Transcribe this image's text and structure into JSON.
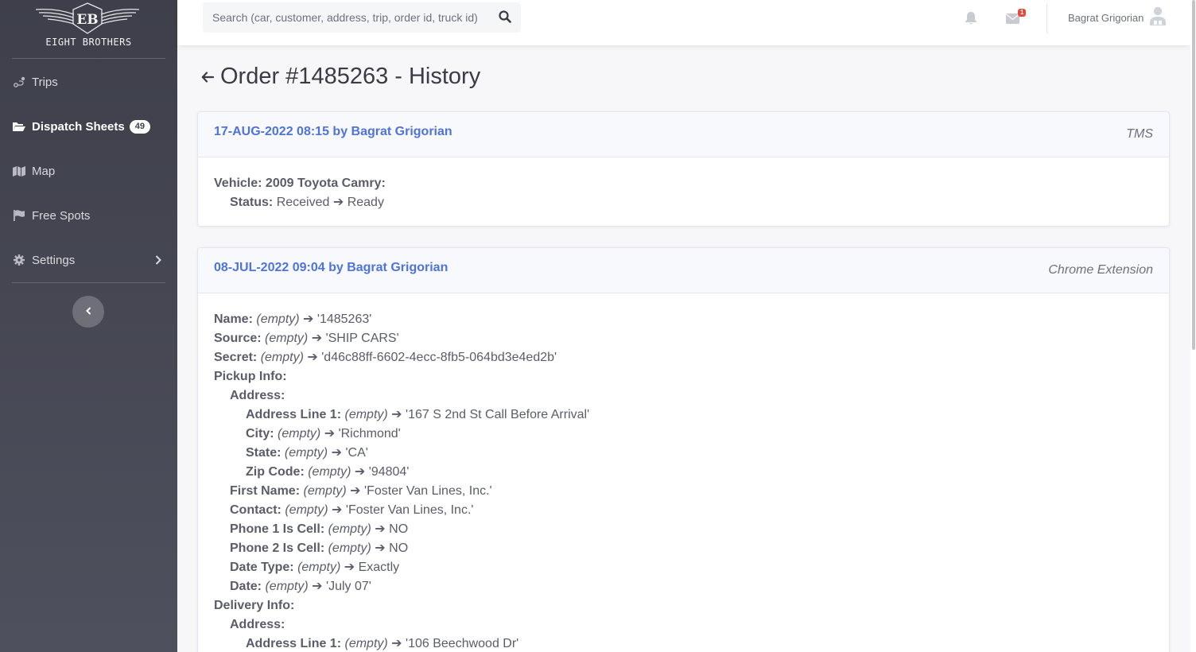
{
  "brand": {
    "name": "EIGHT BROTHERS"
  },
  "sidebar": {
    "items": [
      {
        "label": "Trips",
        "icon": "route-icon"
      },
      {
        "label": "Dispatch Sheets",
        "icon": "folder-open-icon",
        "badge": "49"
      },
      {
        "label": "Map",
        "icon": "map-icon"
      },
      {
        "label": "Free Spots",
        "icon": "flag-icon"
      },
      {
        "label": "Settings",
        "icon": "gear-icon"
      }
    ]
  },
  "topbar": {
    "search_placeholder": "Search (car, customer, address, trip, order id, truck id)",
    "mail_count": "1",
    "user_name": "Bagrat Grigorian"
  },
  "page": {
    "title": "Order #1485263 - History"
  },
  "entries": [
    {
      "header": "17-AUG-2022 08:15 by Bagrat Grigorian",
      "source": "TMS",
      "vehicle_line": "Vehicle: 2009 Toyota Camry:",
      "status_key": "Status:",
      "status_value": "Received ➔ Ready"
    },
    {
      "header": "08-JUL-2022 09:04 by Bagrat Grigorian",
      "source": "Chrome Extension",
      "empty": "(empty)",
      "arrow": "➔",
      "name_key": "Name:",
      "name_val": "'1485263'",
      "source_key": "Source:",
      "source_val": "'SHIP CARS'",
      "secret_key": "Secret:",
      "secret_val": "'d46c88ff-6602-4ecc-8fb5-064bd3e4ed2b'",
      "pickup_key": "Pickup Info:",
      "address_key": "Address:",
      "addr1_key": "Address Line 1:",
      "addr1_val": "'167 S 2nd St Call Before Arrival'",
      "city_key": "City:",
      "city_val": "'Richmond'",
      "state_key": "State:",
      "state_val": "'CA'",
      "zip_key": "Zip Code:",
      "zip_val": "'94804'",
      "first_name_key": "First Name:",
      "first_name_val": "'Foster Van Lines, Inc.'",
      "contact_key": "Contact:",
      "contact_val": "'Foster Van Lines, Inc.'",
      "phone1_key": "Phone 1 Is Cell:",
      "phone1_val": "NO",
      "phone2_key": "Phone 2 Is Cell:",
      "phone2_val": "NO",
      "date_type_key": "Date Type:",
      "date_type_val": "Exactly",
      "date_key": "Date:",
      "date_val": "'July 07'",
      "delivery_key": "Delivery Info:",
      "del_address_key": "Address:",
      "del_addr1_key": "Address Line 1:",
      "del_addr1_val": "'106 Beechwood Dr'"
    }
  ]
}
